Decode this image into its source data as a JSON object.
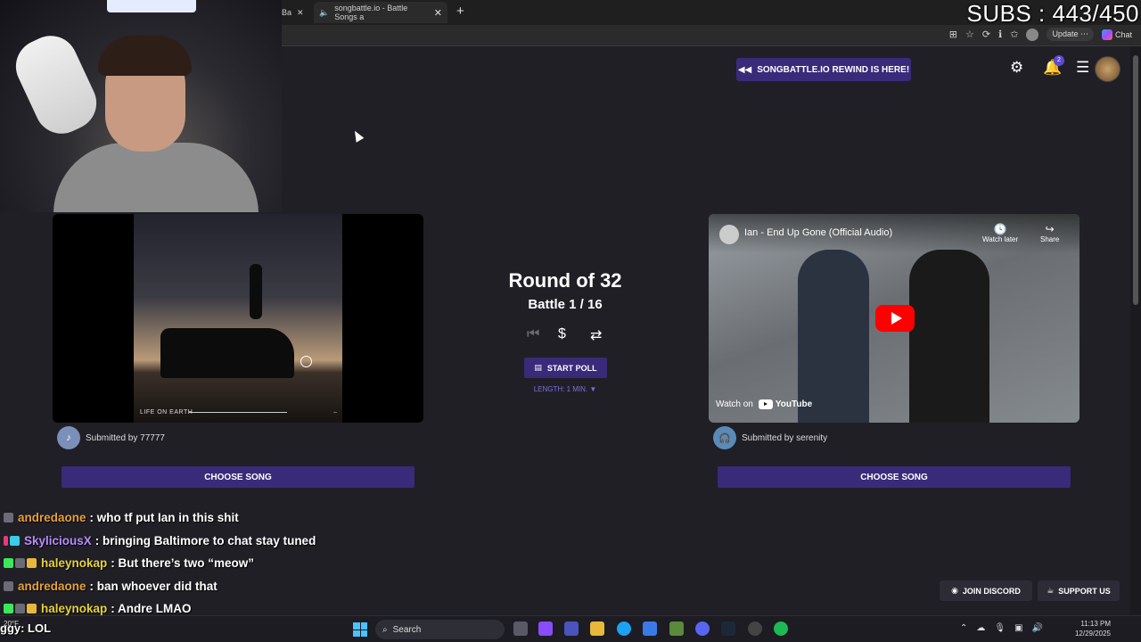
{
  "stream_overlay": {
    "subs_counter": "SUBS : 443/450"
  },
  "browser": {
    "tabs": [
      {
        "label": "Ba"
      },
      {
        "label": "songbattle.io - Battle Songs a"
      }
    ],
    "update_label": "Update",
    "chat_label": "Chat"
  },
  "site": {
    "rewind_banner": "SONGBATTLE.IO REWIND IS HERE!",
    "notification_count": "2",
    "round_title": "Round of 32",
    "battle_counter": "Battle 1 / 16",
    "start_poll_label": "START POLL",
    "length_label": "LENGTH: 1 MIN. ▼",
    "left_song": {
      "album_text": "LIFE ON EARTH",
      "submitted_by": "Submitted by 77777",
      "choose_label": "CHOOSE SONG"
    },
    "right_song": {
      "video_title": "Ian - End Up Gone (Official Audio)",
      "watch_later": "Watch later",
      "share": "Share",
      "watch_on": "Watch on",
      "youtube": "YouTube",
      "submitted_by": "Submitted by serenity",
      "choose_label": "CHOOSE SONG"
    },
    "join_discord": "JOIN DISCORD",
    "support_us": "SUPPORT US"
  },
  "chat": {
    "messages": [
      {
        "user": "andredaone",
        "color": "#e8a13a",
        "text": "who tf put Ian in this shit"
      },
      {
        "user": "SkyliciousX",
        "color": "#b98cff",
        "text": "bringing Baltimore to chat stay tuned"
      },
      {
        "user": "haleynokap",
        "color": "#e8d23a",
        "text": "But there’s two “meow”"
      },
      {
        "user": "andredaone",
        "color": "#e8a13a",
        "text": "ban whoever did that"
      },
      {
        "user": "haleynokap",
        "color": "#e8d23a",
        "text": "Andre LMAO"
      }
    ],
    "partial_line": "ggy: LOL"
  },
  "taskbar": {
    "weather": "20°F",
    "search_label": "Search",
    "time": "11:13 PM",
    "date": "12/29/2025"
  }
}
